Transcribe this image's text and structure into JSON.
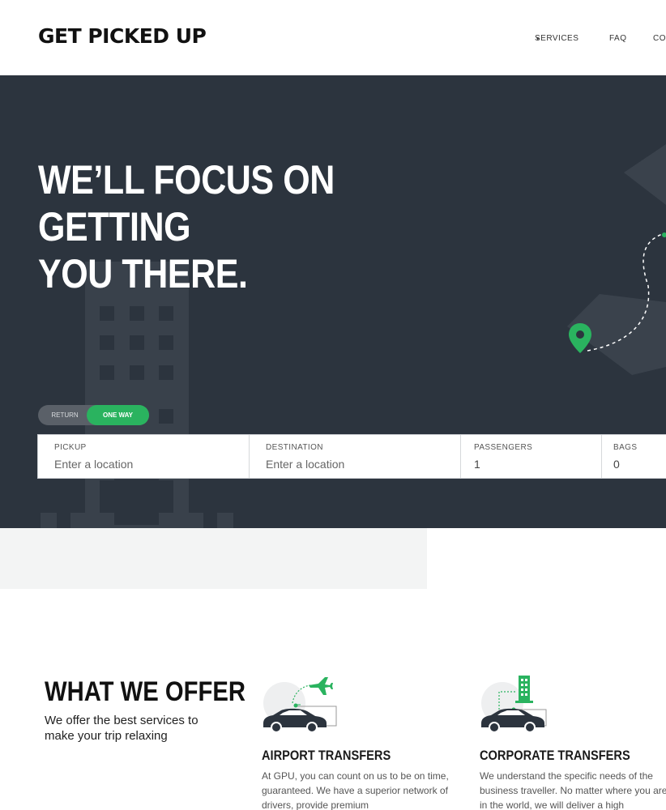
{
  "brand": {
    "logo": "GET PICKED UP"
  },
  "nav": {
    "items": [
      "SERVICES",
      "FAQ",
      "CO"
    ]
  },
  "hero": {
    "title_lines": [
      "WE’LL FOCUS ON",
      "GETTING",
      "YOU THERE."
    ],
    "toggle": {
      "return_label": "RETURN",
      "oneway_label": "ONE WAY",
      "selected": "ONE WAY"
    },
    "booking": {
      "pickup": {
        "label": "PICKUP",
        "placeholder": "Enter a location"
      },
      "destination": {
        "label": "DESTINATION",
        "placeholder": "Enter a location"
      },
      "passengers": {
        "label": "PASSENGERS",
        "value": "1"
      },
      "bags": {
        "label": "BAGS",
        "value": "0"
      }
    }
  },
  "offer": {
    "title": "WHAT WE OFFER",
    "subtitle": "We offer the best services to make your trip relaxing",
    "cards": [
      {
        "title": "AIRPORT TRANSFERS",
        "text": "At GPU, you can count on us to be on time, guaranteed. We have a superior network of drivers, provide premium",
        "icon": "airport-car-icon"
      },
      {
        "title": "CORPORATE TRANSFERS",
        "text": "We understand the specific needs of the business traveller. No matter where you are in the world, we will deliver a high",
        "icon": "corporate-car-icon"
      }
    ]
  },
  "colors": {
    "accent": "#2ab35f",
    "hero_bg": "#2c343e"
  }
}
